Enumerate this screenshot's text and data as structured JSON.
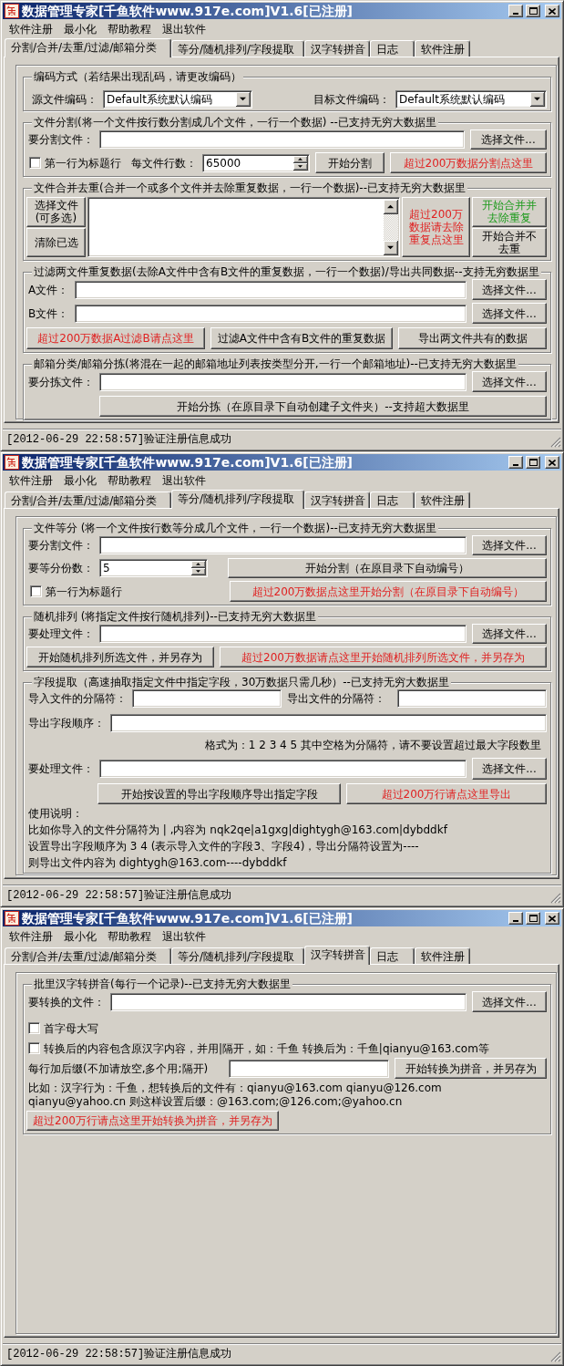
{
  "windows": [
    {
      "title": "数据管理专家[千鱼软件www.917e.com]V1.6[已注册]",
      "menu": [
        "软件注册",
        "最小化",
        "帮助教程",
        "退出软件"
      ],
      "tabs": [
        {
          "label": "分割/合并/去重/过滤/邮箱分类",
          "selected": true
        },
        {
          "label": "等分/随机排列/字段提取",
          "selected": false
        },
        {
          "label": "汉字转拼音",
          "selected": false
        },
        {
          "label": "日志",
          "selected": false
        },
        {
          "label": "软件注册",
          "selected": false
        }
      ],
      "groups": [
        {
          "title": "编码方式（若结果出现乱码，请更改编码）",
          "lines": [
            {
              "controls": [
                {
                  "kind": "label",
                  "text": "源文件编码："
                },
                {
                  "kind": "combo",
                  "value": "Default系统默认编码"
                },
                {
                  "kind": "label",
                  "text": "目标文件编码："
                },
                {
                  "kind": "combo",
                  "value": "Default系统默认编码"
                }
              ]
            }
          ]
        },
        {
          "title": "文件分割(将一个文件按行数分割成几个文件，一行一个数据) --已支持无穷大数据里",
          "lines": [
            {
              "controls": [
                {
                  "kind": "label",
                  "text": "要分割文件："
                },
                {
                  "kind": "field"
                },
                {
                  "kind": "button",
                  "text": "选择文件..."
                }
              ]
            },
            {
              "controls": [
                {
                  "kind": "checkbox",
                  "label": "第一行为标题行",
                  "checked": false
                },
                {
                  "kind": "label",
                  "text": "每文件行数："
                },
                {
                  "kind": "spinner",
                  "value": "65000"
                },
                {
                  "kind": "button",
                  "text": "开始分割"
                },
                {
                  "kind": "button",
                  "text": "超过200万数据分割点这里",
                  "color": "#e02020"
                }
              ]
            }
          ]
        },
        {
          "title": "文件合并去重(合并一个或多个文件并去除重复数据，一行一个数据)--已支持无穷大数据里",
          "lines": [
            {
              "controls": [
                {
                  "kind": "stack",
                  "items": [
                    {
                      "kind": "button",
                      "text": "选择文件(可多选)"
                    },
                    {
                      "kind": "button",
                      "text": "清除已选"
                    }
                  ]
                },
                {
                  "kind": "textarea"
                },
                {
                  "kind": "button",
                  "text": "超过200万数据请去除重复点这里",
                  "color": "#e02020"
                },
                {
                  "kind": "stack",
                  "items": [
                    {
                      "kind": "button",
                      "text": "开始合并并去除重复",
                      "color": "#1a9a1a"
                    },
                    {
                      "kind": "button",
                      "text": "开始合并不去重"
                    }
                  ]
                }
              ]
            }
          ]
        },
        {
          "title": "过滤两文件重复数据(去除A文件中含有B文件的重复数据，一行一个数据)/导出共同数据--支持无穷数据里",
          "lines": [
            {
              "controls": [
                {
                  "kind": "label",
                  "text": "A文件："
                },
                {
                  "kind": "field"
                },
                {
                  "kind": "button",
                  "text": "选择文件..."
                }
              ]
            },
            {
              "controls": [
                {
                  "kind": "label",
                  "text": "B文件："
                },
                {
                  "kind": "field"
                },
                {
                  "kind": "button",
                  "text": "选择文件..."
                }
              ]
            },
            {
              "controls": [
                {
                  "kind": "button",
                  "text": "超过200万数据A过滤B请点这里",
                  "color": "#e02020"
                },
                {
                  "kind": "button",
                  "text": "过滤A文件中含有B文件的重复数据"
                },
                {
                  "kind": "button",
                  "text": "导出两文件共有的数据"
                }
              ]
            }
          ]
        },
        {
          "title": "邮箱分类/邮箱分拣(将混在一起的邮箱地址列表按类型分开,一行一个邮箱地址)--已支持无穷大数据里",
          "lines": [
            {
              "controls": [
                {
                  "kind": "label",
                  "text": "要分拣文件："
                },
                {
                  "kind": "field"
                },
                {
                  "kind": "button",
                  "text": "选择文件..."
                }
              ]
            },
            {
              "controls": [
                {
                  "kind": "button",
                  "text": "开始分拣（在原目录下自动创建子文件夹）--支持超大数据里"
                }
              ]
            }
          ]
        }
      ],
      "status_bar": "[2012-06-29 22:58:57]验证注册信息成功"
    },
    {
      "title": "数据管理专家[千鱼软件www.917e.com]V1.6[已注册]",
      "menu": [
        "软件注册",
        "最小化",
        "帮助教程",
        "退出软件"
      ],
      "tabs": [
        {
          "label": "分割/合并/去重/过滤/邮箱分类",
          "selected": false
        },
        {
          "label": "等分/随机排列/字段提取",
          "selected": true
        },
        {
          "label": "汉字转拼音",
          "selected": false
        },
        {
          "label": "日志",
          "selected": false
        },
        {
          "label": "软件注册",
          "selected": false
        }
      ],
      "groups": [
        {
          "title": "文件等分 (将一个文件按行数等分成几个文件，一行一个数据)--已支持无穷大数据里",
          "lines": [
            {
              "controls": [
                {
                  "kind": "label",
                  "text": "要分割文件："
                },
                {
                  "kind": "field"
                },
                {
                  "kind": "button",
                  "text": "选择文件..."
                }
              ]
            },
            {
              "controls": [
                {
                  "kind": "label",
                  "text": "要等分份数："
                },
                {
                  "kind": "spinner",
                  "value": "5"
                },
                {
                  "kind": "button",
                  "text": "开始分割（在原目录下自动编号）"
                }
              ]
            },
            {
              "controls": [
                {
                  "kind": "checkbox",
                  "label": "第一行为标题行",
                  "checked": false
                },
                {
                  "kind": "button",
                  "text": "超过200万数据点这里开始分割（在原目录下自动编号）",
                  "color": "#e02020"
                }
              ]
            }
          ]
        },
        {
          "title": "随机排列 (将指定文件按行随机排列)--已支持无穷大数据里",
          "lines": [
            {
              "controls": [
                {
                  "kind": "label",
                  "text": "要处理文件："
                },
                {
                  "kind": "field"
                },
                {
                  "kind": "button",
                  "text": "选择文件..."
                }
              ]
            },
            {
              "controls": [
                {
                  "kind": "button",
                  "text": "开始随机排列所选文件，并另存为"
                },
                {
                  "kind": "button",
                  "text": "超过200万数据请点这里开始随机排列所选文件，并另存为",
                  "color": "#e02020"
                }
              ]
            }
          ]
        },
        {
          "title": "字段提取（高速抽取指定文件中指定字段，30万数据只需几秒）--已支持无穷大数据里",
          "lines": [
            {
              "controls": [
                {
                  "kind": "label",
                  "text": "导入文件的分隔符："
                },
                {
                  "kind": "field"
                },
                {
                  "kind": "label",
                  "text": "导出文件的分隔符："
                },
                {
                  "kind": "field"
                }
              ]
            },
            {
              "controls": [
                {
                  "kind": "label",
                  "text": "导出字段顺序："
                },
                {
                  "kind": "field"
                }
              ]
            },
            {
              "controls": [
                {
                  "kind": "note",
                  "text": "格式为：1 2 3 4 5 其中空格为分隔符，请不要设置超过最大字段数里"
                }
              ]
            },
            {
              "controls": [
                {
                  "kind": "label",
                  "text": "要处理文件："
                },
                {
                  "kind": "field"
                },
                {
                  "kind": "button",
                  "text": "选择文件..."
                }
              ]
            },
            {
              "controls": [
                {
                  "kind": "button",
                  "text": "开始按设置的导出字段顺序导出指定字段"
                },
                {
                  "kind": "button",
                  "text": "超过200万行请点这里导出",
                  "color": "#e02020"
                }
              ]
            },
            {
              "controls": [
                {
                  "kind": "note",
                  "text": "使用说明："
                }
              ]
            },
            {
              "controls": [
                {
                  "kind": "note",
                  "text": "比如你导入的文件分隔符为 | ,内容为 nqk2qe|a1gxg|dightygh@163.com|dybddkf"
                }
              ]
            },
            {
              "controls": [
                {
                  "kind": "note",
                  "text": "设置导出字段顺序为 3 4 (表示导入文件的字段3、字段4)，导出分隔符设置为----"
                }
              ]
            },
            {
              "controls": [
                {
                  "kind": "note",
                  "text": "则导出文件内容为 dightygh@163.com----dybddkf"
                }
              ]
            }
          ]
        }
      ],
      "status_bar": "[2012-06-29 22:58:57]验证注册信息成功"
    },
    {
      "title": "数据管理专家[千鱼软件www.917e.com]V1.6[已注册]",
      "menu": [
        "软件注册",
        "最小化",
        "帮助教程",
        "退出软件"
      ],
      "tabs": [
        {
          "label": "分割/合并/去重/过滤/邮箱分类",
          "selected": false
        },
        {
          "label": "等分/随机排列/字段提取",
          "selected": false
        },
        {
          "label": "汉字转拼音",
          "selected": true
        },
        {
          "label": "日志",
          "selected": false
        },
        {
          "label": "软件注册",
          "selected": false
        }
      ],
      "groups": [
        {
          "title": "批里汉字转拼音(每行一个记录)--已支持无穷大数据里",
          "lines": [
            {
              "controls": [
                {
                  "kind": "label",
                  "text": "要转换的文件："
                },
                {
                  "kind": "field"
                },
                {
                  "kind": "button",
                  "text": "选择文件..."
                }
              ]
            },
            {
              "controls": [
                {
                  "kind": "checkbox",
                  "label": "首字母大写",
                  "checked": false
                }
              ]
            },
            {
              "controls": [
                {
                  "kind": "checkbox",
                  "label": "转换后的内容包含原汉字内容，并用|隔开，如：千鱼 转换后为：千鱼|qianyu@163.com等",
                  "checked": false
                }
              ]
            },
            {
              "controls": [
                {
                  "kind": "label",
                  "text": "每行加后缀(不加请放空,多个用;隔开)"
                },
                {
                  "kind": "field"
                },
                {
                  "kind": "button",
                  "text": "开始转换为拼音，并另存为"
                }
              ]
            },
            {
              "controls": [
                {
                  "kind": "note",
                  "text": "比如：汉字行为：千鱼，想转换后的文件有：qianyu@163.com qianyu@126.com\nqianyu@yahoo.cn 则这样设置后缀：@163.com;@126.com;@yahoo.cn"
                }
              ]
            },
            {
              "controls": [
                {
                  "kind": "button",
                  "text": "超过200万行请点这里开始转换为拼音，并另存为",
                  "color": "#e02020"
                }
              ]
            }
          ]
        }
      ],
      "status_bar": "[2012-06-29 22:58:57]验证注册信息成功"
    }
  ]
}
